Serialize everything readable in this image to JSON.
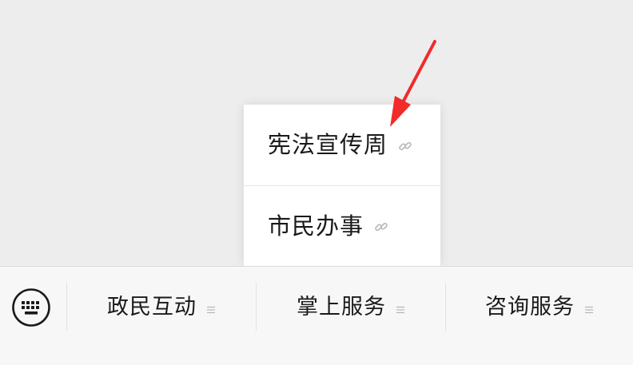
{
  "popup": {
    "items": [
      {
        "label": "宪法宣传周",
        "icon": "link-icon"
      },
      {
        "label": "市民办事",
        "icon": "link-icon"
      }
    ]
  },
  "menu_bar": {
    "keyboard_icon": "keyboard-icon",
    "items": [
      {
        "label": "政民互动",
        "icon": "submenu-lines-icon"
      },
      {
        "label": "掌上服务",
        "icon": "submenu-lines-icon"
      },
      {
        "label": "咨询服务",
        "icon": "submenu-lines-icon"
      }
    ]
  },
  "colors": {
    "background": "#ededed",
    "menu_bar_bg": "#f7f7f7",
    "popup_bg": "#ffffff",
    "text": "#1a1a1a",
    "icon_gray": "#b5b5b5",
    "annotation_red": "#f22a2a"
  }
}
